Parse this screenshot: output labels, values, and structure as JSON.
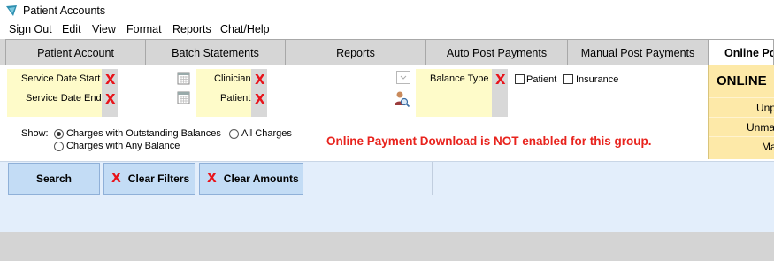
{
  "window": {
    "title": "Patient Accounts"
  },
  "menu": [
    "Sign Out",
    "Edit",
    "View",
    "Format",
    "Reports",
    "Chat/Help"
  ],
  "tabs": [
    "Patient Account",
    "Batch Statements",
    "Reports",
    "Auto Post Payments",
    "Manual Post Payments",
    "Online Pos"
  ],
  "filters": {
    "service_date_start": "Service Date Start",
    "service_date_end": "Service Date End",
    "clinician": "Clinician",
    "patient": "Patient",
    "balance_type": "Balance Type",
    "patient_checkbox": "Patient",
    "insurance_checkbox": "Insurance",
    "clear_mark": "X"
  },
  "show": {
    "label": "Show:",
    "options": [
      "Charges with Outstanding Balances",
      "All Charges",
      "Charges with Any Balance"
    ],
    "selected": "Charges with Outstanding Balances"
  },
  "warning": "Online Payment Download is NOT enabled for this group.",
  "online_panel": {
    "title": "ONLINE",
    "rows": [
      "Unp",
      "Unma",
      "Ma"
    ]
  },
  "buttons": {
    "search": "Search",
    "clear_filters": "Clear Filters",
    "clear_amounts": "Clear Amounts",
    "clear_mark": "X"
  },
  "colors": {
    "accent_red": "#e8141b",
    "filter_yellow": "#fefbc9",
    "button_blue": "#c3dcf5",
    "online_gold": "#fde9a8"
  }
}
